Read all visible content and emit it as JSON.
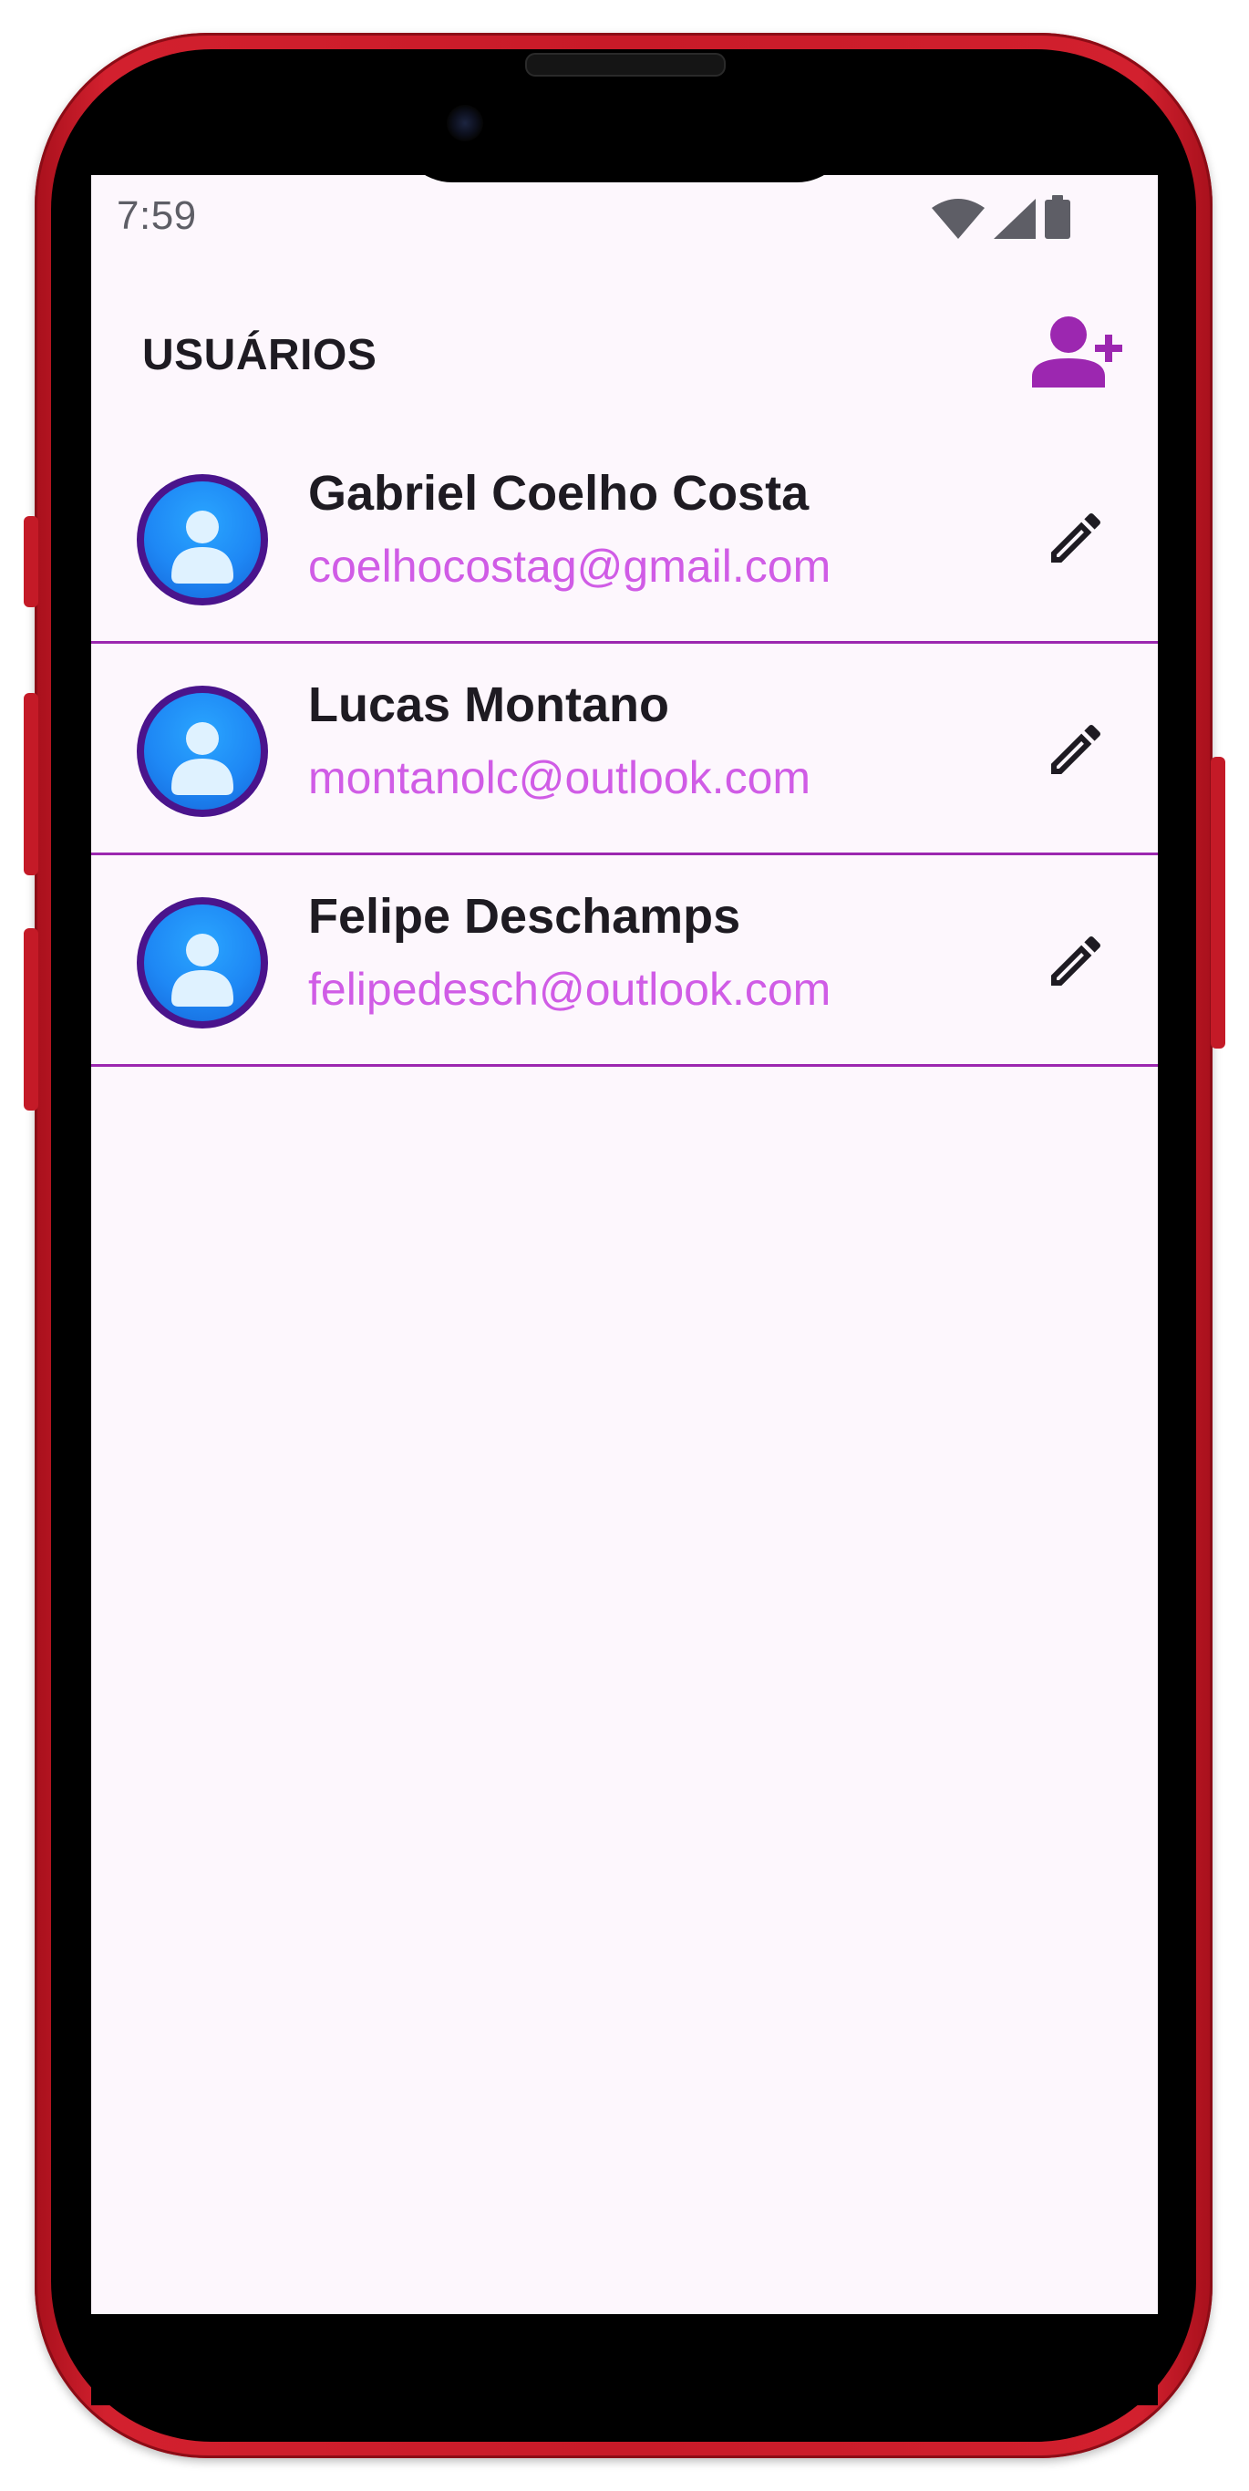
{
  "status_bar": {
    "time": "7:59",
    "icons": [
      "wifi-icon",
      "cellular-signal-icon",
      "battery-icon"
    ]
  },
  "header": {
    "title": "USUÁRIOS",
    "add_user_icon": "person-add-icon"
  },
  "users": [
    {
      "name": "Gabriel Coelho Costa",
      "email": "coelhocostag@gmail.com"
    },
    {
      "name": "Lucas Montano",
      "email": "montanolc@outlook.com"
    },
    {
      "name": "Felipe Deschamps",
      "email": "felipedesch@outlook.com"
    }
  ],
  "colors": {
    "accent": "#9c27b0",
    "email": "#d05ce6",
    "avatar_ring": "#4a148c",
    "avatar_fill": "#1e88f5",
    "frame": "#c81a28",
    "background": "#fdf7fd"
  }
}
